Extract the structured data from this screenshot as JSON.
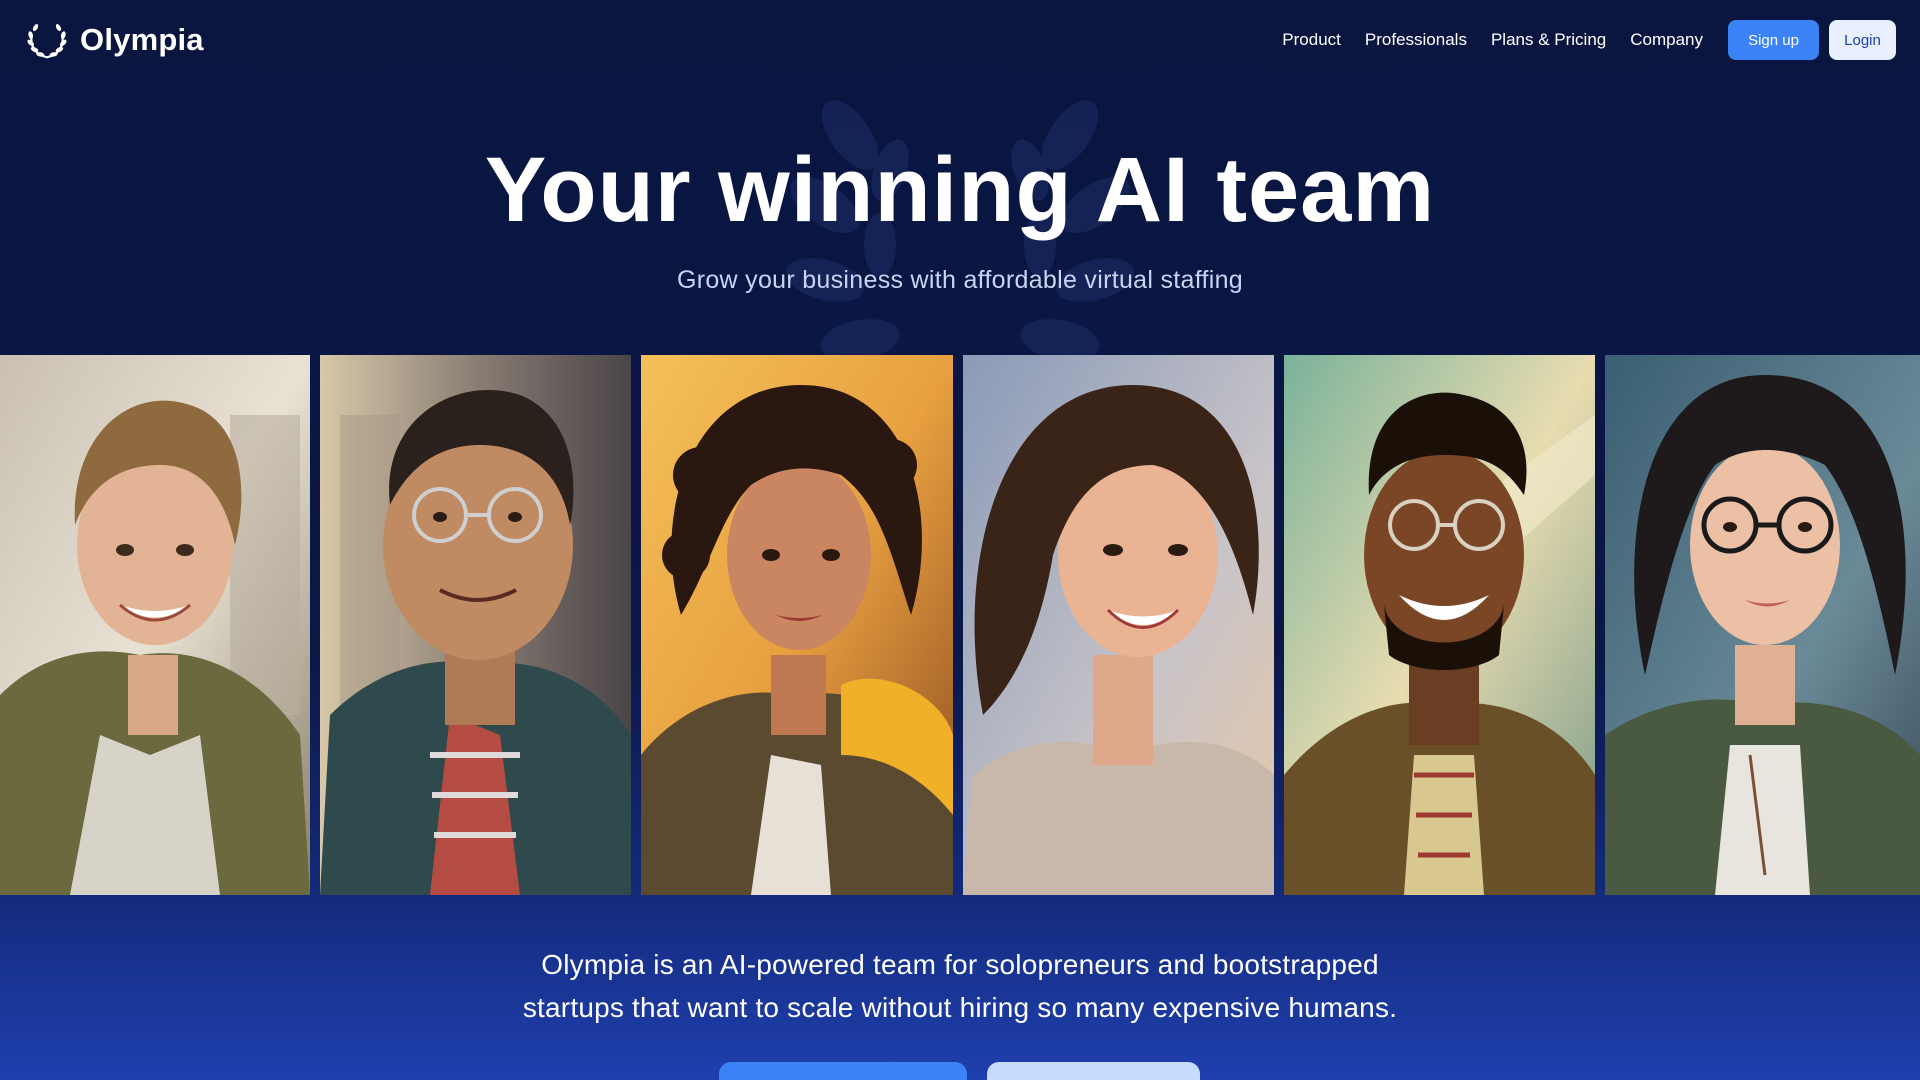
{
  "brand": {
    "name": "Olympia",
    "logo_icon": "laurel-wreath-icon"
  },
  "nav": {
    "links": [
      "Product",
      "Professionals",
      "Plans & Pricing",
      "Company"
    ],
    "signup_label": "Sign up",
    "login_label": "Login"
  },
  "hero": {
    "title": "Your winning AI team",
    "subtitle": "Grow your business with affordable virtual staffing",
    "emblem_icon": "laurel-wreath-icon"
  },
  "gallery": {
    "portraits": [
      {
        "name": "portrait-young-man-smiling"
      },
      {
        "name": "portrait-man-with-glasses"
      },
      {
        "name": "portrait-woman-curly-hair-yellow-hoodie"
      },
      {
        "name": "portrait-woman-smiling"
      },
      {
        "name": "portrait-man-with-glasses-laughing"
      },
      {
        "name": "portrait-woman-with-glasses"
      }
    ]
  },
  "about": {
    "line1": "Olympia is an AI-powered team for solopreneurs and bootstrapped",
    "line2": "startups that want to scale without hiring so many expensive humans."
  },
  "colors": {
    "background": "#0a1540",
    "accent": "#3b82f6",
    "login_bg": "#e8efff"
  }
}
